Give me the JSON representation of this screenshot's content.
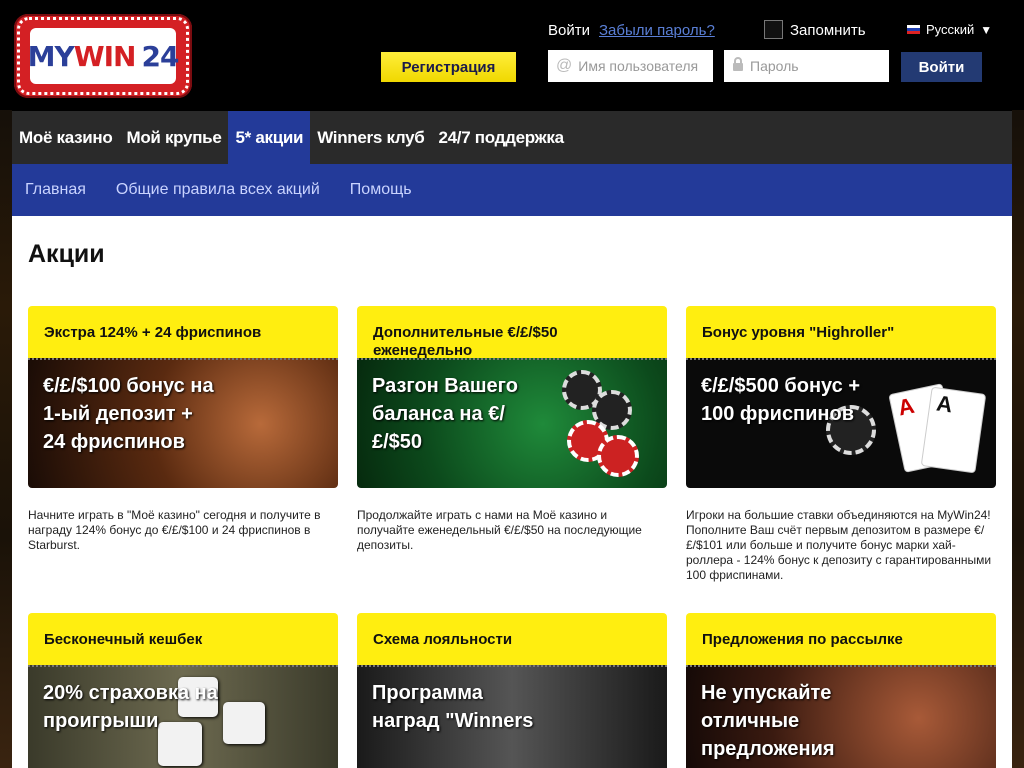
{
  "logo": {
    "part1": "MY",
    "part2": "WIN",
    "part3": "24"
  },
  "header": {
    "register_label": "Регистрация",
    "login_label": "Войти",
    "forgot_label": "Забыли пароль?",
    "remember_label": "Запомнить",
    "language": "Русский",
    "username_placeholder": "Имя пользователя",
    "password_placeholder": "Пароль",
    "login_button": "Войти"
  },
  "nav": {
    "items": [
      {
        "label": "Моё казино"
      },
      {
        "label": "Мой крупье"
      },
      {
        "label": "5* акции"
      },
      {
        "label": "Winners клуб"
      },
      {
        "label": "24/7 поддержка"
      }
    ],
    "active_index": 2
  },
  "subnav": {
    "items": [
      {
        "label": "Главная"
      },
      {
        "label": "Общие правила всех акций"
      },
      {
        "label": "Помощь"
      }
    ]
  },
  "page": {
    "title": "Акции"
  },
  "cards": [
    {
      "title": "Экстра 124% + 24 фриспинов",
      "image_text": "€/£/$100 бонус на 1-ый депозит + 24 фриспинов",
      "description": "Начните играть в \"Моё казино\" сегодня и получите в награду 124% бонус до €/£/$100 и 24 фриспинов в Starburst."
    },
    {
      "title": "Дополнительные €/£/$50 еженедельно",
      "image_text": "Разгон Вашего баланса на €/£/$50",
      "description": "Продолжайте играть с нами на Моё казино и получайте еженедельный €/£/$50 на последующие депозиты."
    },
    {
      "title": "Бонус уровня \"Highroller\"",
      "image_text": "€/£/$500 бонус + 100 фриспинов",
      "description": "Игроки на большие ставки объединяются на MyWin24! Пополните Ваш счёт первым депозитом в размере €/£/$101 или больше и получите бонус марки хай-роллера - 124% бонус к депозиту с гарантированными 100 фриспинами."
    },
    {
      "title": "Бесконечный кешбек",
      "image_text": "20% страховка на проигрыши",
      "description": ""
    },
    {
      "title": "Схема лояльности",
      "image_text": "Программа наград \"Winners",
      "description": ""
    },
    {
      "title": "Предложения по рассылке",
      "image_text": "Не упускайте отличные предложения",
      "description": ""
    }
  ],
  "colors": {
    "nav_bg": "#2a2a2a",
    "accent_blue": "#233a99",
    "yellow": "#ffee10",
    "brand_red": "#d42024"
  },
  "icons": {
    "user": "at-sign-icon",
    "password": "lock-icon",
    "language_dropdown": "chevron-down-icon"
  }
}
